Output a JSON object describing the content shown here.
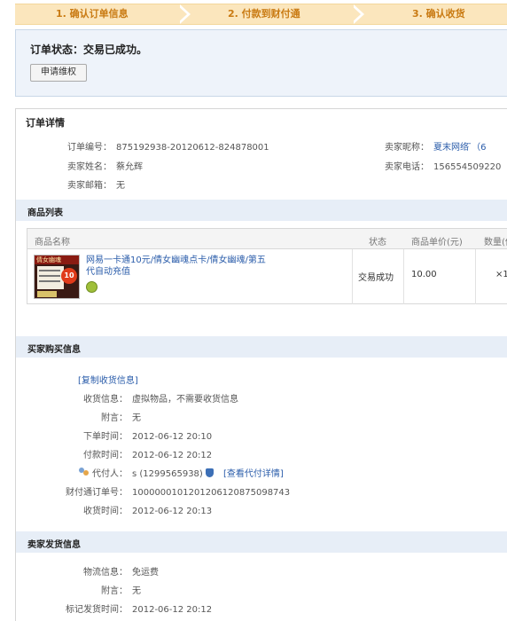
{
  "steps": [
    "1. 确认订单信息",
    "2. 付款到财付通",
    "3. 确认收货"
  ],
  "status": {
    "title": "订单状态：交易已成功。",
    "appeal_button": "申请维权"
  },
  "order": {
    "title": "订单详情",
    "order_no_label": "订单编号：",
    "order_no": "875192938-20120612-824878001",
    "seller_name_label": "卖家姓名：",
    "seller_name": "蔡允辉",
    "seller_email_label": "卖家邮箱：",
    "seller_email": "无",
    "seller_nick_label": "卖家昵称：",
    "seller_nick": "夏末网络 ̄（6",
    "seller_phone_label": "卖家电话：",
    "seller_phone": "156554509220"
  },
  "goods": {
    "section_title": "商品列表",
    "columns": [
      "商品名称",
      "状态",
      "商品单价(元)",
      "数量(件"
    ],
    "item": {
      "thumb_text": "倩女幽魂",
      "thumb_badge": "10",
      "title": "网易一卡通10元/倩女幽魂点卡/倩女幽魂/第五代自动充值",
      "status": "交易成功",
      "price": "10.00",
      "qty": "×1"
    }
  },
  "buyer": {
    "section_title": "买家购买信息",
    "copy_link": "[复制收货信息]",
    "rows": [
      {
        "label": "收货信息：",
        "value": "虚拟物品，不需要收货信息"
      },
      {
        "label": "附言：",
        "value": "无"
      },
      {
        "label": "下单时间：",
        "value": "2012-06-12 20:10"
      },
      {
        "label": "付款时间：",
        "value": "2012-06-12 20:12"
      }
    ],
    "payer_label": "代付人：",
    "payer_value": "s (1299565938)",
    "payer_link": "[查看代付详情]",
    "tenpay_label": "财付通订单号：",
    "tenpay_value": "1000000101201206120875098743",
    "receive_label": "收货时间：",
    "receive_value": "2012-06-12 20:13"
  },
  "shipping": {
    "section_title": "卖家发货信息",
    "rows": [
      {
        "label": "物流信息：",
        "value": "免运费"
      },
      {
        "label": "附言：",
        "value": "无"
      },
      {
        "label": "标记发货时间：",
        "value": "2012-06-12 20:12"
      }
    ]
  }
}
